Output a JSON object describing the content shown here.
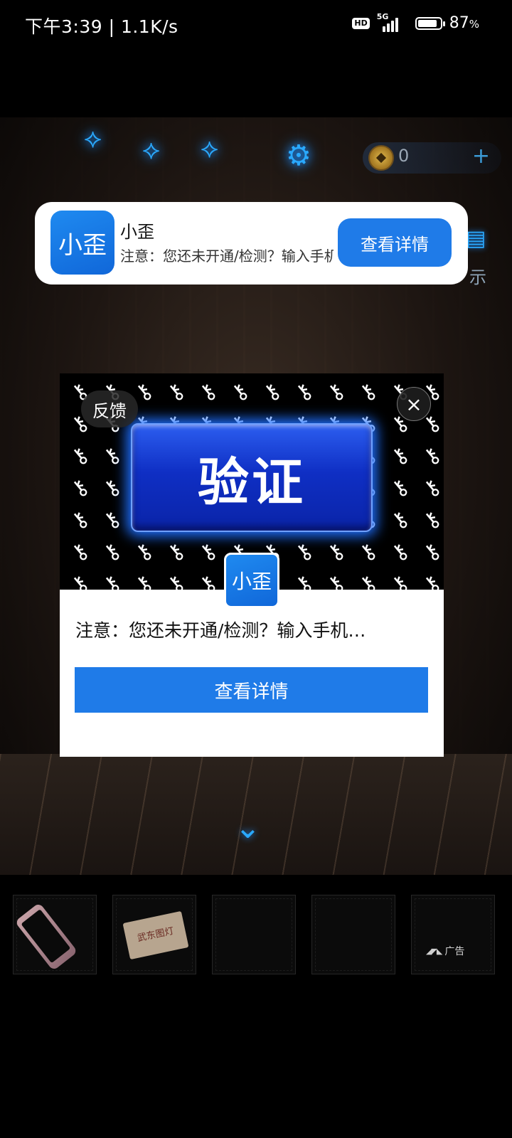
{
  "status_bar": {
    "time_speed": "下午3:39 | 1.1K/s",
    "hd_label": "HD",
    "network_label": "5G",
    "battery_percent": "87",
    "battery_suffix": "%",
    "battery_level": 0.87
  },
  "game": {
    "coin_count": "0",
    "coin_plus": "+",
    "side_label_partial": "示"
  },
  "inventory": {
    "paper_text": "武东图灯",
    "ad_logo": "◢◤◣",
    "ad_label": "广告"
  },
  "notification": {
    "app_icon_text": "小歪",
    "title": "小歪",
    "body": "注意：您还未开通/检测？输入手机号查询",
    "button_label": "查看详情"
  },
  "popup": {
    "feedback_label": "反馈",
    "close_glyph": "×",
    "verify_label": "验证",
    "app_icon_text": "小歪",
    "text": "注意：您还未开通/检测？输入手机…",
    "cta_label": "查看详情"
  },
  "colors": {
    "accent_blue": "#1f7be8",
    "verify_blue": "#0f2fc4",
    "glow_blue": "#2aa9ff"
  },
  "icons": [
    "butterfly-icon",
    "gear-icon",
    "coin-icon",
    "book-icon",
    "key-icon",
    "close-icon",
    "chevron-down-icon"
  ]
}
